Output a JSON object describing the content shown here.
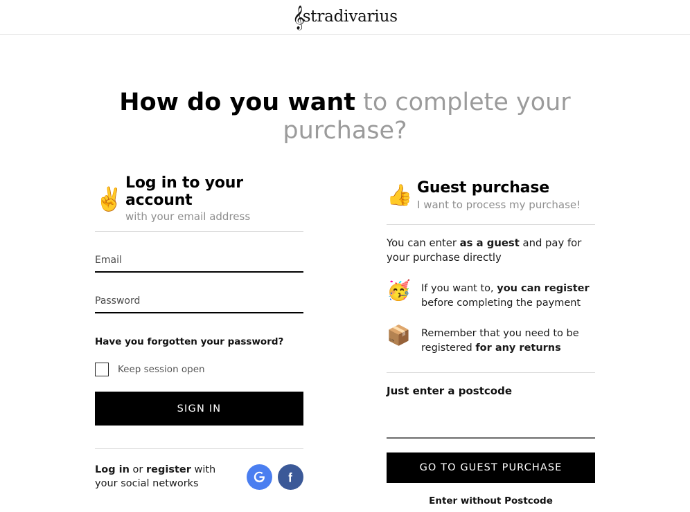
{
  "header": {
    "logo_text": "stradivarius",
    "logo_clef": "𝄞"
  },
  "heading": {
    "bold_part": "How do you want",
    "light_part": " to complete your purchase?"
  },
  "login": {
    "emoji": "✌️",
    "emoji_name": "victory-hand-emoji",
    "title": "Log in to your account",
    "subtitle": "with your email address",
    "email_placeholder": "Email",
    "email_value": "",
    "password_placeholder": "Password",
    "password_value": "",
    "forgot_password": "Have you forgotten your password?",
    "keep_session_label": "Keep session open",
    "keep_session_checked": false,
    "sign_in_label": "SIGN IN",
    "social_text_1": "Log in",
    "social_text_2": " or ",
    "social_text_3": "register",
    "social_text_4": " with your social networks",
    "google_label": "G",
    "facebook_label": "f",
    "google_color": "#4a7ef0",
    "facebook_color": "#3b5998"
  },
  "guest": {
    "emoji": "👍",
    "emoji_name": "thumbs-up-emoji",
    "title": "Guest purchase",
    "subtitle": "I want to process my purchase!",
    "lead_1": "You can enter ",
    "lead_2": "as a guest",
    "lead_3": " and pay for your purchase directly",
    "info": [
      {
        "emoji": "🥳",
        "emoji_name": "partying-face-emoji",
        "text_1": "If you want to, ",
        "text_2": "you can register",
        "text_3": " before completing the payment"
      },
      {
        "emoji": "📦",
        "emoji_name": "package-emoji",
        "text_1": "Remember that you need to be registered ",
        "text_2": "for any returns",
        "text_3": ""
      }
    ],
    "postcode_title": "Just enter a postcode",
    "postcode_placeholder": "",
    "postcode_value": "",
    "go_button_label": "GO TO GUEST PURCHASE",
    "without_postcode_label": "Enter without Postcode"
  }
}
